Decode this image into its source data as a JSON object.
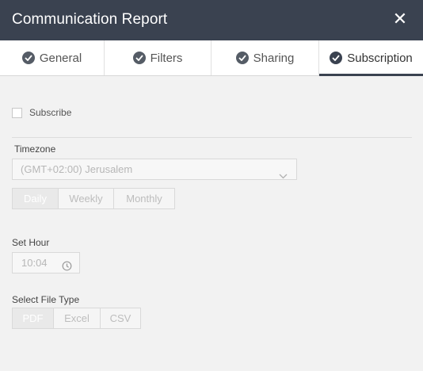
{
  "window": {
    "title": "Communication Report",
    "close_glyph": "✕"
  },
  "tabs": [
    {
      "label": "General",
      "icon": "check-circle-icon"
    },
    {
      "label": "Filters",
      "icon": "check-circle-icon"
    },
    {
      "label": "Sharing",
      "icon": "check-circle-icon"
    },
    {
      "label": "Subscription",
      "icon": "check-circle-icon",
      "active": true
    }
  ],
  "subscription": {
    "subscribe_label": "Subscribe",
    "subscribe_checked": false,
    "timezone_label": "Timezone",
    "timezone_value": "(GMT+02:00) Jerusalem",
    "frequency_options": [
      "Daily",
      "Weekly",
      "Monthly"
    ],
    "frequency_selected": "Daily",
    "set_hour_label": "Set Hour",
    "hour_value": "10:04",
    "file_type_label": "Select File Type",
    "file_type_options": [
      "PDF",
      "Excel",
      "CSV"
    ],
    "file_type_selected": "PDF"
  },
  "colors": {
    "header_bg": "#3a4250",
    "content_bg": "#f2f2f2",
    "disabled_text": "#b7b7b7"
  }
}
